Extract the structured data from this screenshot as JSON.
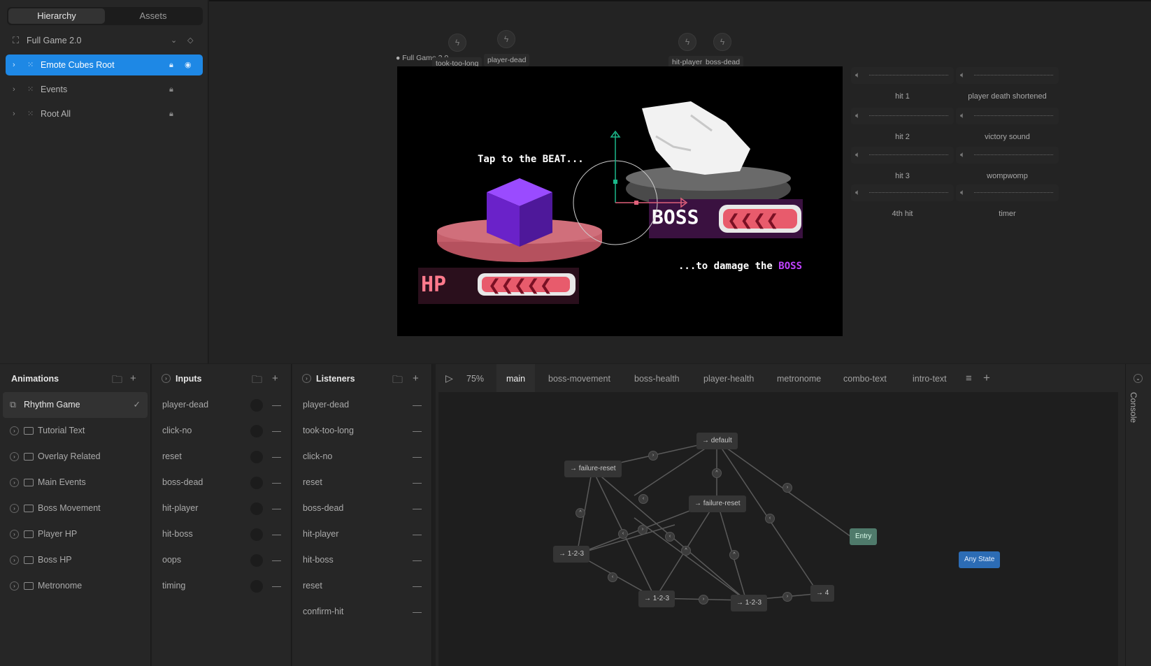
{
  "hierarchy": {
    "tabs": [
      "Hierarchy",
      "Assets"
    ],
    "scene": "Full Game 2.0",
    "items": [
      {
        "label": "Emote Cubes Root"
      },
      {
        "label": "Events"
      },
      {
        "label": "Root All"
      }
    ]
  },
  "stage": {
    "artboard_label": "Full Game 2.0",
    "event_pins": [
      "took-too-long",
      "player-dead",
      "hit-player",
      "boss-dead"
    ],
    "texts": {
      "tap": "Tap to the BEAT...",
      "damage_prefix": "...to damage the ",
      "damage_boss": "BOSS",
      "hp": "HP",
      "boss": "BOSS"
    }
  },
  "audio": [
    {
      "name": "hit 1"
    },
    {
      "name": "player death shortened"
    },
    {
      "name": "hit 2"
    },
    {
      "name": "victory sound"
    },
    {
      "name": "hit 3"
    },
    {
      "name": "wompwomp"
    },
    {
      "name": "4th hit"
    },
    {
      "name": "timer"
    }
  ],
  "animations": {
    "title": "Animations",
    "selected": "Rhythm Game",
    "folders": [
      "Tutorial Text",
      "Overlay Related",
      "Main Events",
      "Boss Movement",
      "Player HP",
      "Boss HP",
      "Metronome"
    ]
  },
  "inputs": {
    "title": "Inputs",
    "items": [
      "player-dead",
      "click-no",
      "reset",
      "boss-dead",
      "hit-player",
      "hit-boss",
      "oops",
      "timing"
    ]
  },
  "listeners": {
    "title": "Listeners",
    "items": [
      "player-dead",
      "took-too-long",
      "click-no",
      "reset",
      "boss-dead",
      "hit-player",
      "hit-boss",
      "reset",
      "confirm-hit"
    ]
  },
  "graph": {
    "zoom": "75%",
    "tabs": [
      "main",
      "boss-movement",
      "boss-health",
      "player-health",
      "metronome",
      "combo-text",
      "intro-text"
    ],
    "nodes": {
      "default": "→ default",
      "failure_reset_1": "→ failure-reset",
      "failure_reset_2": "→ failure-reset",
      "a123": "→ 1-2-3",
      "b123": "→ 1-2-3",
      "c123": "→ 1-2-3",
      "four": "→ 4",
      "entry": "Entry",
      "any": "Any State"
    }
  },
  "console": {
    "label": "Console"
  },
  "colors": {
    "accent": "#1e88e5",
    "boss_purple": "#c042ff",
    "entry": "#4f7a6b",
    "any_state": "#2c6cb5"
  }
}
